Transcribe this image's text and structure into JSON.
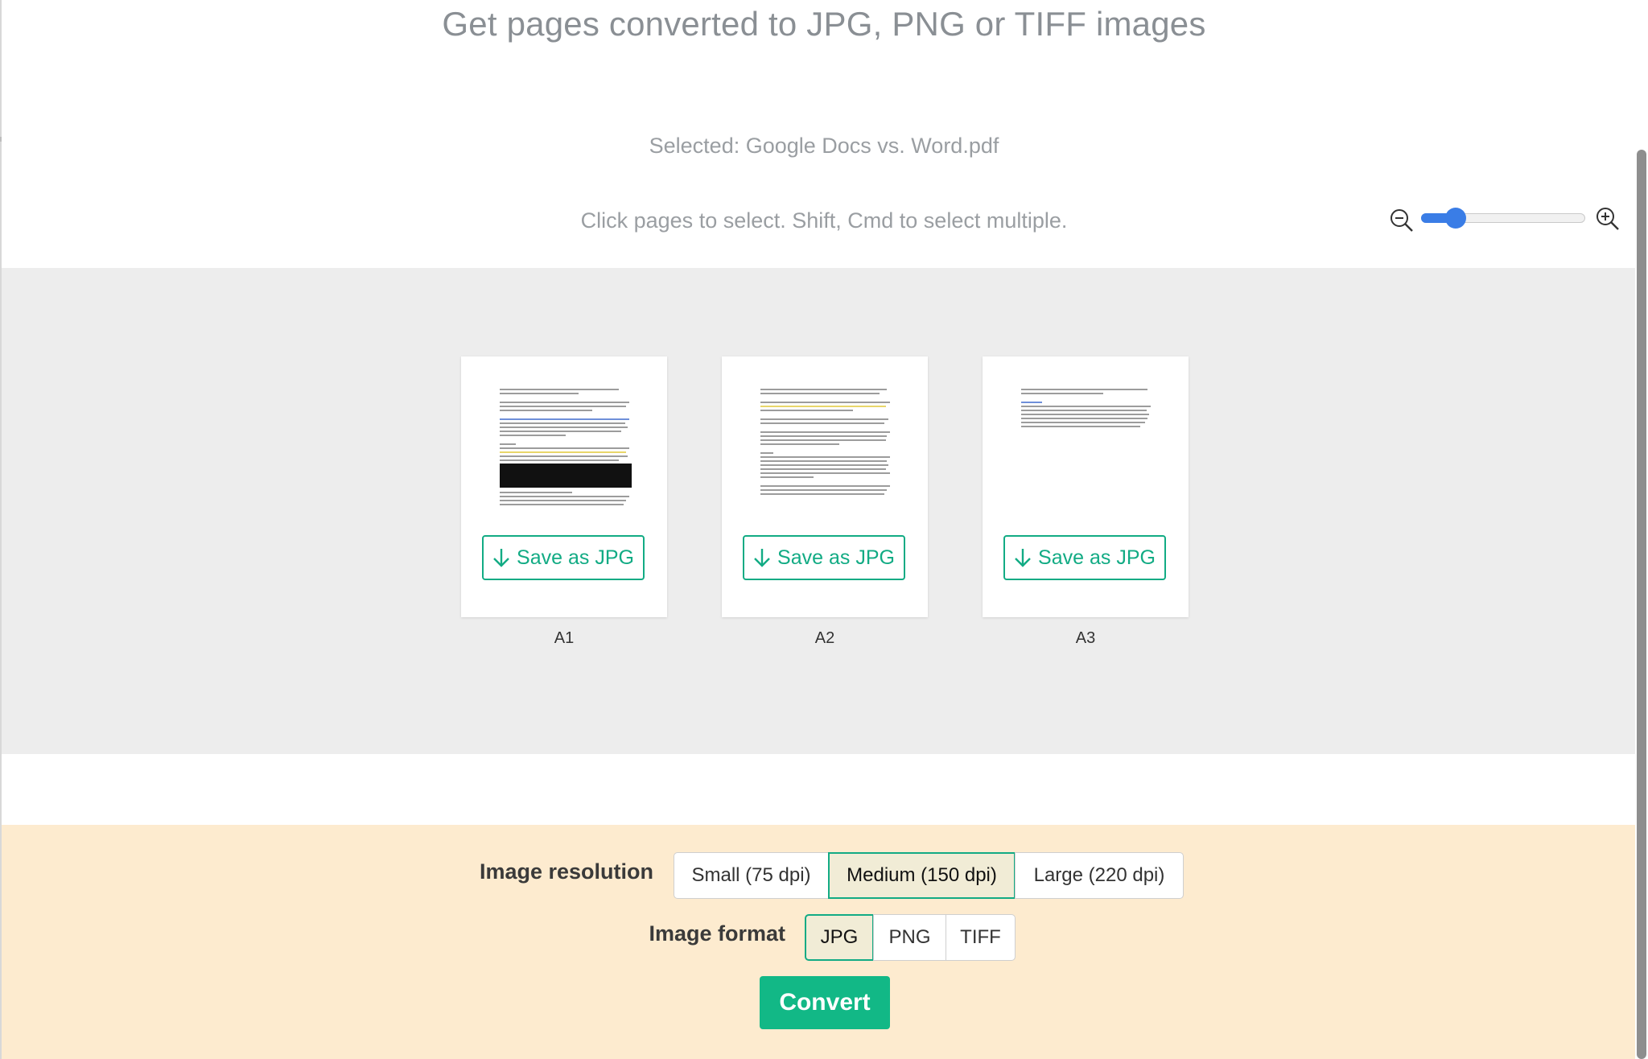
{
  "header": {
    "title": "Get pages converted to JPG, PNG or TIFF images",
    "selected": "Selected: Google Docs vs. Word.pdf",
    "hint": "Click pages to select. Shift, Cmd to select multiple."
  },
  "zoom": {
    "level_fraction": 0.17
  },
  "pages": [
    {
      "label": "A1",
      "save_label": "Save as JPG"
    },
    {
      "label": "A2",
      "save_label": "Save as JPG"
    },
    {
      "label": "A3",
      "save_label": "Save as JPG"
    }
  ],
  "options": {
    "resolution": {
      "label": "Image resolution",
      "items": [
        "Small (75 dpi)",
        "Medium (150 dpi)",
        "Large (220 dpi)"
      ],
      "selected": "Medium (150 dpi)"
    },
    "format": {
      "label": "Image format",
      "items": [
        "JPG",
        "PNG",
        "TIFF"
      ],
      "selected": "JPG"
    }
  },
  "convert_label": "Convert",
  "colors": {
    "accent": "#12ab84",
    "slider": "#3a7de6",
    "options_bg": "#fdebcf",
    "pages_bg": "#ededed"
  },
  "icons": [
    "zoom-out-icon",
    "zoom-in-icon",
    "download-arrow-icon"
  ]
}
